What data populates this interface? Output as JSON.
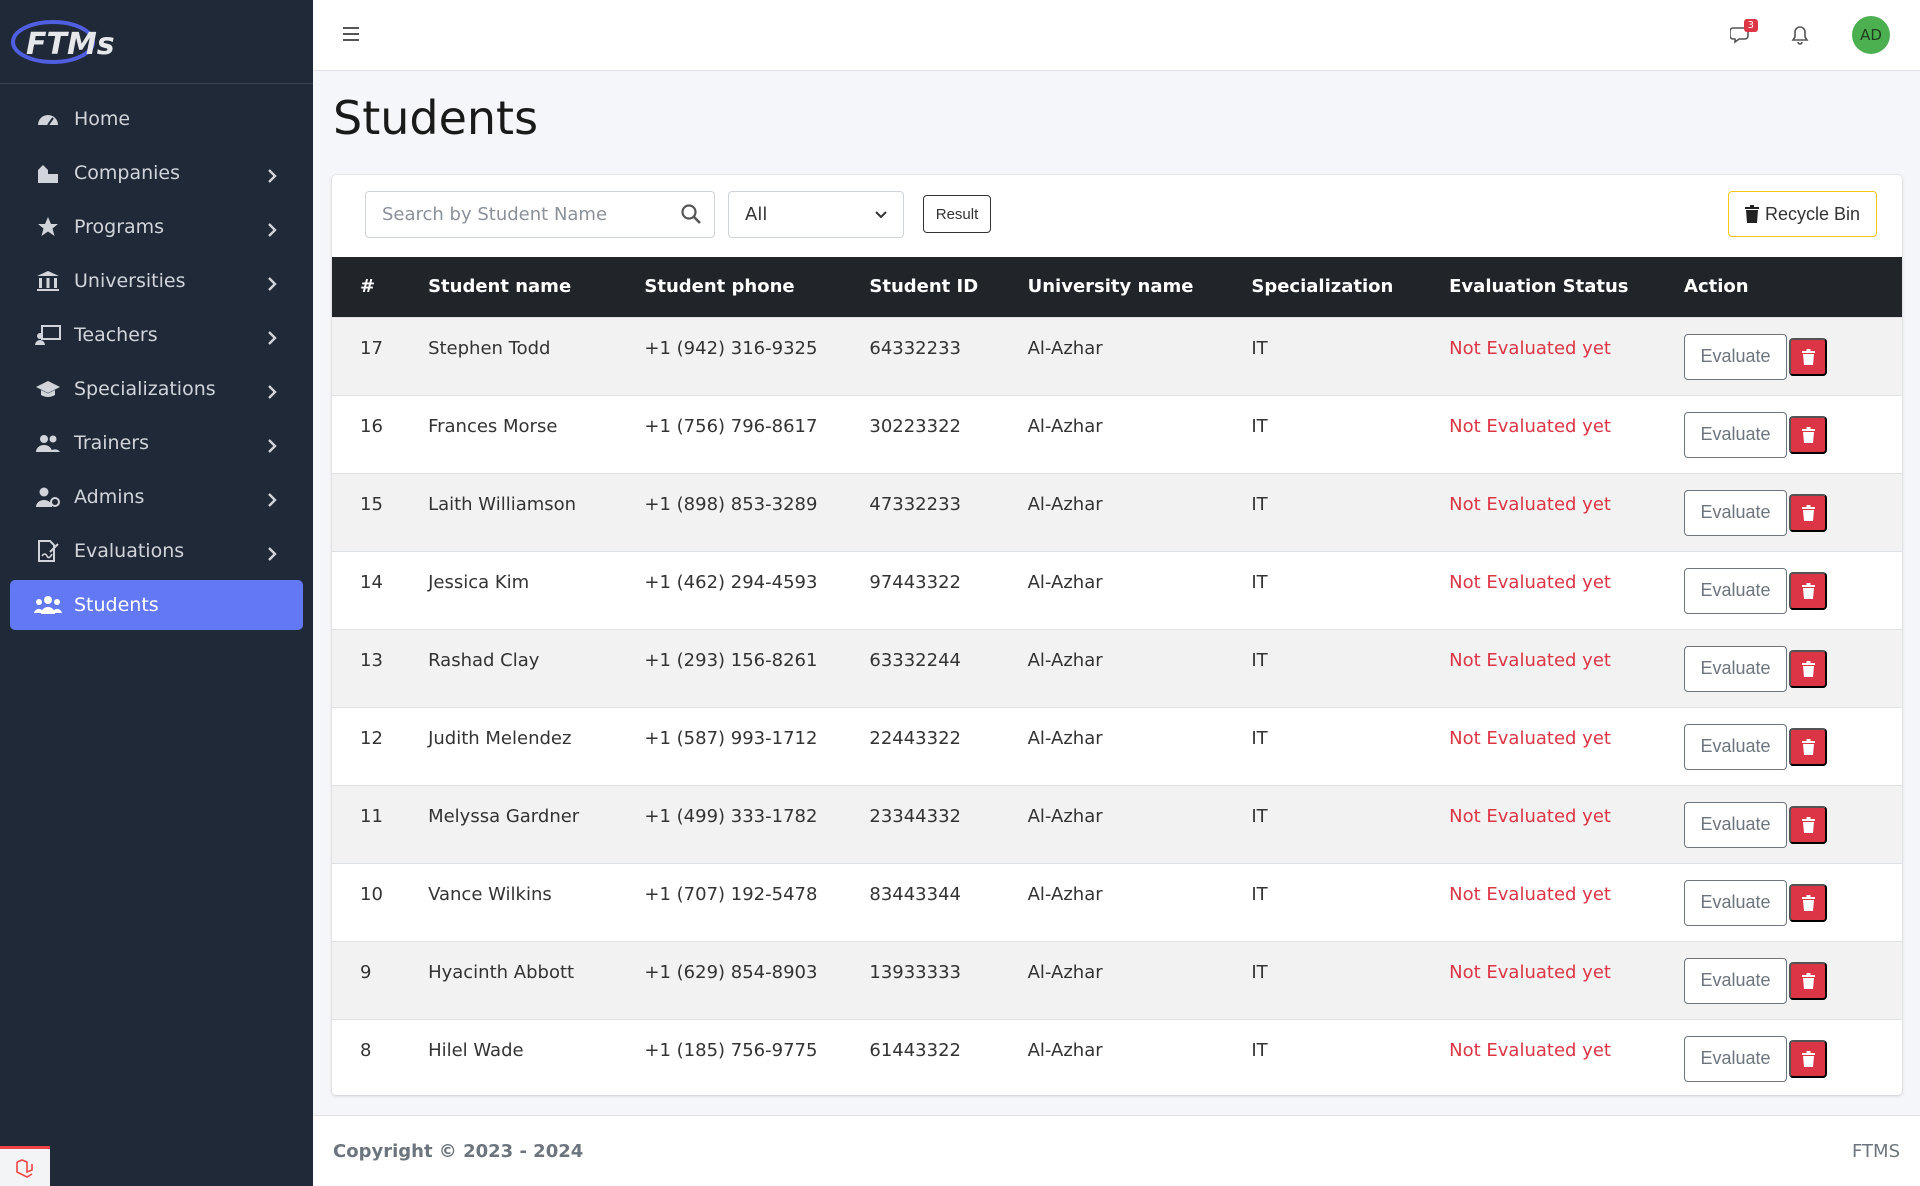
{
  "brand": {
    "logo_text": "FTMs"
  },
  "sidebar": {
    "items": [
      {
        "label": "Home",
        "icon": "gauge-icon",
        "has_chevron": false,
        "active": false
      },
      {
        "label": "Companies",
        "icon": "building-icon",
        "has_chevron": true,
        "active": false
      },
      {
        "label": "Programs",
        "icon": "star-icon",
        "has_chevron": true,
        "active": false
      },
      {
        "label": "Universities",
        "icon": "university-icon",
        "has_chevron": true,
        "active": false
      },
      {
        "label": "Teachers",
        "icon": "chalkboard-teacher-icon",
        "has_chevron": true,
        "active": false
      },
      {
        "label": "Specializations",
        "icon": "graduation-cap-icon",
        "has_chevron": true,
        "active": false
      },
      {
        "label": "Trainers",
        "icon": "users-icon",
        "has_chevron": true,
        "active": false
      },
      {
        "label": "Admins",
        "icon": "user-gear-icon",
        "has_chevron": true,
        "active": false
      },
      {
        "label": "Evaluations",
        "icon": "file-signature-icon",
        "has_chevron": true,
        "active": false
      },
      {
        "label": "Students",
        "icon": "user-group-icon",
        "has_chevron": false,
        "active": true
      }
    ]
  },
  "topbar": {
    "messages_badge": "3",
    "avatar_initials": "AD"
  },
  "page": {
    "title": "Students"
  },
  "toolbar": {
    "search_placeholder": "Search by Student Name",
    "filter_selected": "All",
    "result_label": "Result",
    "recycle_label": "Recycle Bin"
  },
  "table": {
    "columns": [
      "#",
      "Student name",
      "Student phone",
      "Student ID",
      "University name",
      "Specialization",
      "Evaluation Status",
      "Action"
    ],
    "rows": [
      {
        "num": "17",
        "name": "Stephen Todd",
        "phone": "+1 (942) 316-9325",
        "id": "64332233",
        "university": "Al-Azhar",
        "spec": "IT",
        "status": "Not Evaluated yet"
      },
      {
        "num": "16",
        "name": "Frances Morse",
        "phone": "+1 (756) 796-8617",
        "id": "30223322",
        "university": "Al-Azhar",
        "spec": "IT",
        "status": "Not Evaluated yet"
      },
      {
        "num": "15",
        "name": "Laith Williamson",
        "phone": "+1 (898) 853-3289",
        "id": "47332233",
        "university": "Al-Azhar",
        "spec": "IT",
        "status": "Not Evaluated yet"
      },
      {
        "num": "14",
        "name": "Jessica Kim",
        "phone": "+1 (462) 294-4593",
        "id": "97443322",
        "university": "Al-Azhar",
        "spec": "IT",
        "status": "Not Evaluated yet"
      },
      {
        "num": "13",
        "name": "Rashad Clay",
        "phone": "+1 (293) 156-8261",
        "id": "63332244",
        "university": "Al-Azhar",
        "spec": "IT",
        "status": "Not Evaluated yet"
      },
      {
        "num": "12",
        "name": "Judith Melendez",
        "phone": "+1 (587) 993-1712",
        "id": "22443322",
        "university": "Al-Azhar",
        "spec": "IT",
        "status": "Not Evaluated yet"
      },
      {
        "num": "11",
        "name": "Melyssa Gardner",
        "phone": "+1 (499) 333-1782",
        "id": "23344332",
        "university": "Al-Azhar",
        "spec": "IT",
        "status": "Not Evaluated yet"
      },
      {
        "num": "10",
        "name": "Vance Wilkins",
        "phone": "+1 (707) 192-5478",
        "id": "83443344",
        "university": "Al-Azhar",
        "spec": "IT",
        "status": "Not Evaluated yet"
      },
      {
        "num": "9",
        "name": "Hyacinth Abbott",
        "phone": "+1 (629) 854-8903",
        "id": "13933333",
        "university": "Al-Azhar",
        "spec": "IT",
        "status": "Not Evaluated yet"
      },
      {
        "num": "8",
        "name": "Hilel Wade",
        "phone": "+1 (185) 756-9775",
        "id": "61443322",
        "university": "Al-Azhar",
        "spec": "IT",
        "status": "Not Evaluated yet"
      }
    ],
    "evaluate_label": "Evaluate"
  },
  "footer": {
    "copyright": "Copyright © 2023 - 2024",
    "right_text": "FTMS"
  },
  "colors": {
    "sidebar_bg": "#1f2937",
    "active_item": "#6378f4",
    "danger": "#dc3545",
    "table_header": "#212529",
    "avatar_bg": "#4caf50"
  }
}
